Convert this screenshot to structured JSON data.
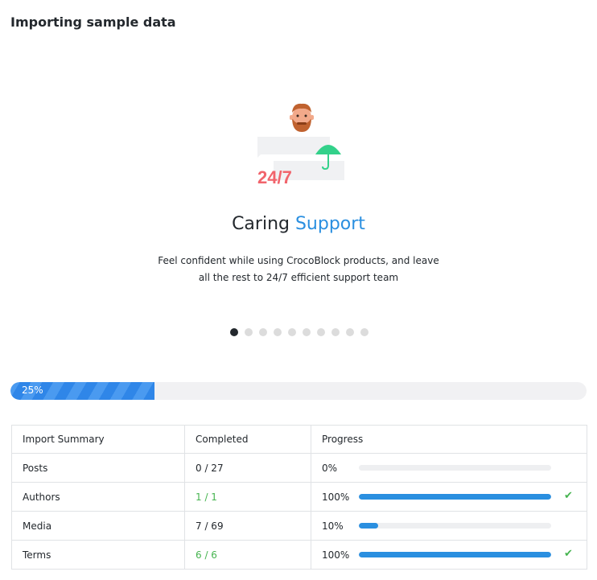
{
  "page": {
    "title": "Importing sample data"
  },
  "slide": {
    "badge_text": "24/7",
    "headline_plain": "Caring ",
    "headline_accent": "Support",
    "description_line1": "Feel confident while using CrocoBlock products, and leave",
    "description_line2": "all the rest to 24/7 efficient support team",
    "accent_color": "#2a8fe0",
    "dots_total": 10,
    "active_dot": 1
  },
  "overall_progress": {
    "label": "25%",
    "value": 25
  },
  "summary": {
    "headers": [
      "Import Summary",
      "Completed",
      "Progress"
    ],
    "rows": [
      {
        "name": "Posts",
        "completed": "0 / 27",
        "progress": "0%",
        "value": 0,
        "done": false
      },
      {
        "name": "Authors",
        "completed": "1 / 1",
        "progress": "100%",
        "value": 100,
        "done": true
      },
      {
        "name": "Media",
        "completed": "7 / 69",
        "progress": "10%",
        "value": 10,
        "done": false
      },
      {
        "name": "Terms",
        "completed": "6 / 6",
        "progress": "100%",
        "value": 100,
        "done": true
      }
    ],
    "done_color": "#46b450"
  }
}
